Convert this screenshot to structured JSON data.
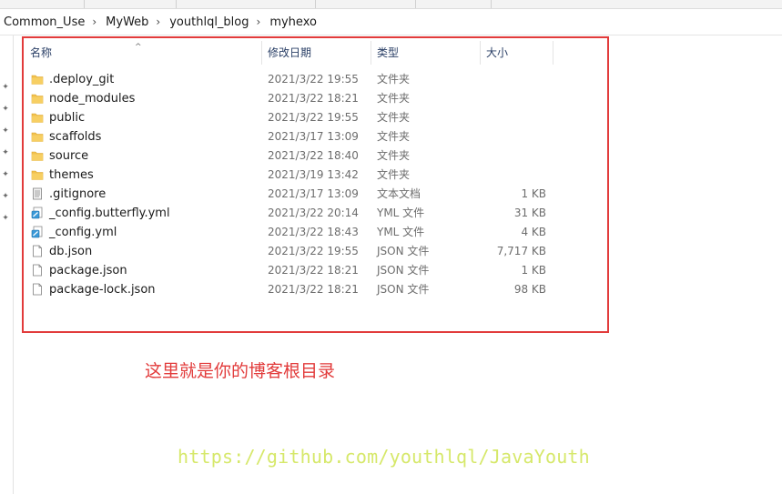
{
  "breadcrumb": {
    "items": [
      "Common_Use",
      "MyWeb",
      "youthlql_blog",
      "myhexo"
    ],
    "separator": "›"
  },
  "columns": {
    "name": "名称",
    "date": "修改日期",
    "type": "类型",
    "size": "大小"
  },
  "files": [
    {
      "name": ".deploy_git",
      "date": "2021/3/22 19:55",
      "type": "文件夹",
      "size": "",
      "icon": "folder-icon"
    },
    {
      "name": "node_modules",
      "date": "2021/3/22 18:21",
      "type": "文件夹",
      "size": "",
      "icon": "folder-icon"
    },
    {
      "name": "public",
      "date": "2021/3/22 19:55",
      "type": "文件夹",
      "size": "",
      "icon": "folder-icon"
    },
    {
      "name": "scaffolds",
      "date": "2021/3/17 13:09",
      "type": "文件夹",
      "size": "",
      "icon": "folder-icon"
    },
    {
      "name": "source",
      "date": "2021/3/22 18:40",
      "type": "文件夹",
      "size": "",
      "icon": "folder-icon"
    },
    {
      "name": "themes",
      "date": "2021/3/19 13:42",
      "type": "文件夹",
      "size": "",
      "icon": "folder-icon"
    },
    {
      "name": ".gitignore",
      "date": "2021/3/17 13:09",
      "type": "文本文档",
      "size": "1 KB",
      "icon": "text-file-icon"
    },
    {
      "name": "_config.butterfly.yml",
      "date": "2021/3/22 20:14",
      "type": "YML 文件",
      "size": "31 KB",
      "icon": "yml-file-icon"
    },
    {
      "name": "_config.yml",
      "date": "2021/3/22 18:43",
      "type": "YML 文件",
      "size": "4 KB",
      "icon": "yml-file-icon"
    },
    {
      "name": "db.json",
      "date": "2021/3/22 19:55",
      "type": "JSON 文件",
      "size": "7,717 KB",
      "icon": "file-icon"
    },
    {
      "name": "package.json",
      "date": "2021/3/22 18:21",
      "type": "JSON 文件",
      "size": "1 KB",
      "icon": "file-icon"
    },
    {
      "name": "package-lock.json",
      "date": "2021/3/22 18:21",
      "type": "JSON 文件",
      "size": "98 KB",
      "icon": "file-icon"
    }
  ],
  "annotation": {
    "caption": "这里就是你的博客根目录",
    "watermark": "https://github.com/youthlql/JavaYouth"
  },
  "colors": {
    "highlight_box": "#e23b3b",
    "folder": "#f2c14e",
    "watermark": "#d6e86a"
  }
}
